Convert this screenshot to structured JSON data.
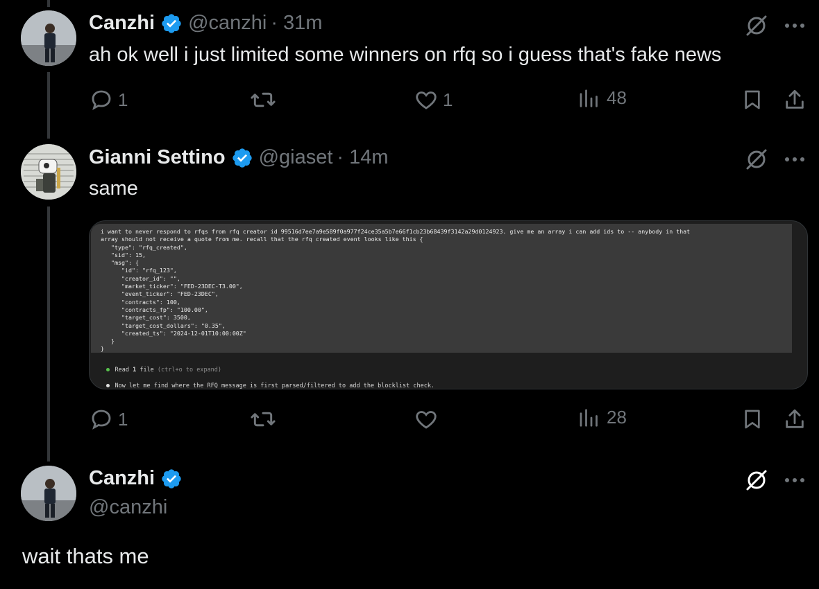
{
  "colors": {
    "background": "#000000",
    "text_primary": "#e7e9ea",
    "text_secondary": "#71767b",
    "verified_badge": "#1d9bf0",
    "thread_line": "#333639"
  },
  "tweets": [
    {
      "name": "Canzhi",
      "handle": "@canzhi",
      "time": "· 31m",
      "text": "ah ok well i just limited some winners on rfq so i guess that's fake news",
      "actions": {
        "replies": "1",
        "reposts": "",
        "likes": "1",
        "views": "48"
      }
    },
    {
      "name": "Gianni Settino",
      "handle": "@giaset",
      "time": "· 14m",
      "text": "same",
      "actions": {
        "replies": "1",
        "reposts": "",
        "likes": "",
        "views": "28"
      },
      "media": {
        "code": "i want to never respond to rfqs from rfq creator id 99516d7ee7a9e589f0a977f24ce35a5b7e66f1cb23b68439f3142a29d0124923. give me an array i can add ids to -- anybody in that\narray should not receive a quote from me. recall that the rfq created event looks like this {\n   \"type\": \"rfq_created\",\n   \"sid\": 15,\n   \"msg\": {\n      \"id\": \"rfq_123\",\n      \"creator_id\": \"\",\n      \"market_ticker\": \"FED-23DEC-T3.00\",\n      \"event_ticker\": \"FED-23DEC\",\n      \"contracts\": 100,\n      \"contracts_fp\": \"100.00\",\n      \"target_cost\": 3500,\n      \"target_cost_dollars\": \"0.35\",\n      \"created_ts\": \"2024-12-01T10:00:00Z\"\n   }\n}",
        "read_label": "Read ",
        "read_count": "1",
        "read_suffix": " file ",
        "read_hint": "(ctrl+o to expand)",
        "next_step": "Now let me find where the RFQ message is first parsed/filtered to add the blocklist check."
      }
    },
    {
      "name": "Canzhi",
      "handle": "@canzhi",
      "text": "wait thats me"
    }
  ]
}
